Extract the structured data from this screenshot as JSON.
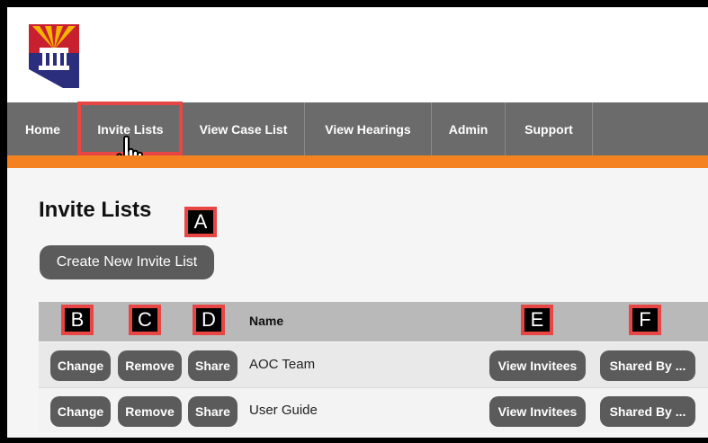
{
  "nav": {
    "items": [
      {
        "label": "Home"
      },
      {
        "label": "Invite Lists"
      },
      {
        "label": "View Case List"
      },
      {
        "label": "View Hearings"
      },
      {
        "label": "Admin"
      },
      {
        "label": "Support"
      }
    ]
  },
  "page": {
    "title": "Invite Lists",
    "create_button": "Create New Invite List"
  },
  "table": {
    "header_name": "Name",
    "rows": [
      {
        "change": "Change",
        "remove": "Remove",
        "share": "Share",
        "name": "AOC Team",
        "view_invitees": "View Invitees",
        "shared_by": "Shared By ..."
      },
      {
        "change": "Change",
        "remove": "Remove",
        "share": "Share",
        "name": "User Guide",
        "view_invitees": "View Invitees",
        "shared_by": "Shared By ..."
      }
    ]
  },
  "annotations": {
    "a": "A",
    "b": "B",
    "c": "C",
    "d": "D",
    "e": "E",
    "f": "F"
  },
  "colors": {
    "nav_bg": "#6b6b6b",
    "accent_orange": "#f58220",
    "highlight_red": "#e84545",
    "button_bg": "#5b5b5b"
  },
  "icons": [
    "arizona-courts-logo",
    "hand-pointer-icon"
  ]
}
